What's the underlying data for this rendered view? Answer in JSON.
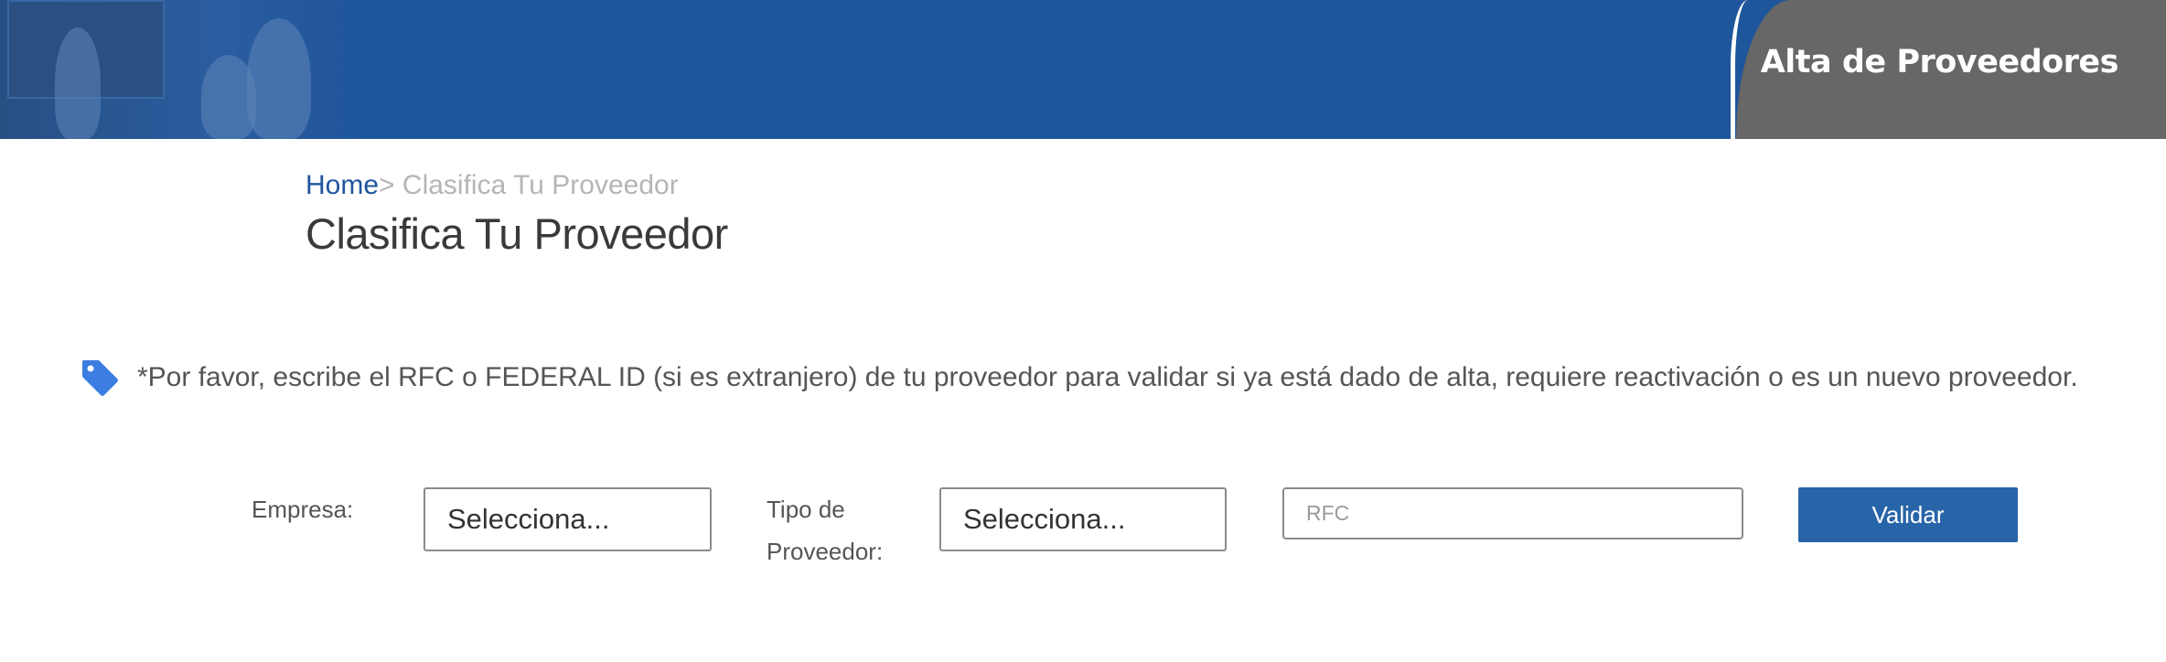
{
  "header": {
    "title": "Alta de Proveedores",
    "banner_color": "#1f559b",
    "badge_color": "#676767"
  },
  "breadcrumb": {
    "home": "Home",
    "separator": ">",
    "current": " Clasifica Tu Proveedor"
  },
  "page": {
    "title": "Clasifica Tu Proveedor"
  },
  "notice": {
    "icon": "tag-icon",
    "text": "*Por favor, escribe el RFC o FEDERAL ID (si es extranjero) de tu proveedor para validar si ya está dado de alta, requiere reactivación o es un nuevo proveedor."
  },
  "form": {
    "empresa_label": "Empresa:",
    "empresa_selected": "Selecciona...",
    "tipo_label_line1": "Tipo de",
    "tipo_label_line2": "Proveedor:",
    "tipo_selected": "Selecciona...",
    "rfc_placeholder": "RFC",
    "validar_label": "Validar"
  },
  "colors": {
    "link": "#1f559b",
    "button": "#2864a8",
    "tag_icon": "#3b7de0"
  }
}
